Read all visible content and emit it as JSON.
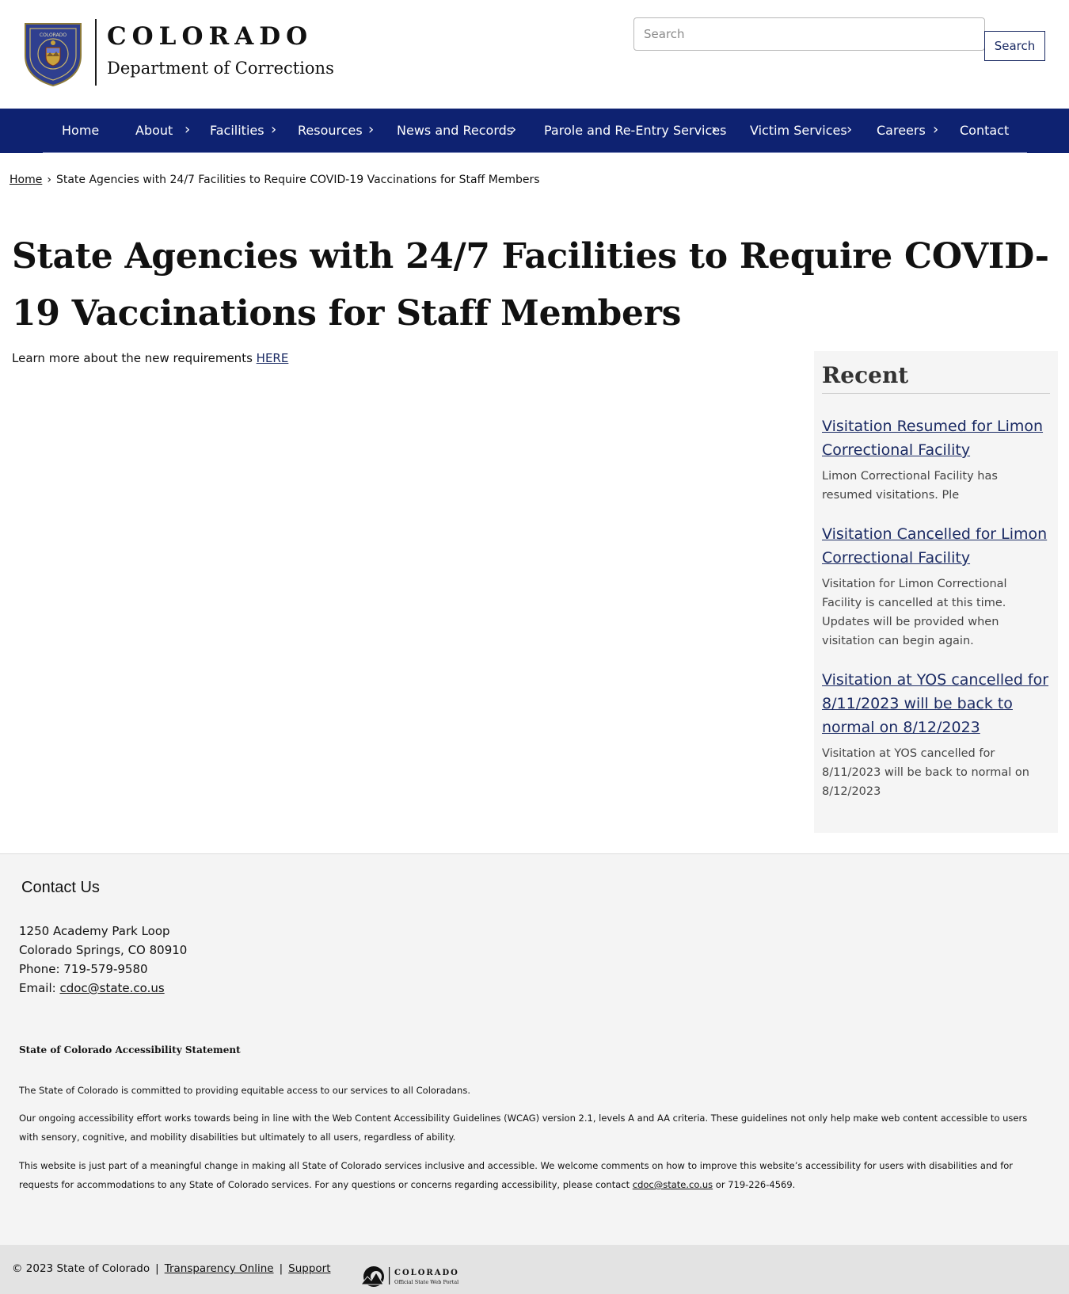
{
  "header": {
    "brand_co": "COLORADO",
    "brand_dept": "Department of Corrections",
    "search_placeholder": "Search",
    "search_button": "Search"
  },
  "nav": {
    "items": [
      {
        "label": "Home"
      },
      {
        "label": "About",
        "has_chevron": true
      },
      {
        "label": "Facilities",
        "has_chevron": true
      },
      {
        "label": "Resources",
        "has_chevron": true
      },
      {
        "label": "News and Records",
        "has_chevron": true
      },
      {
        "label": "Parole and Re-Entry Services",
        "has_chevron": true
      },
      {
        "label": "Victim Services",
        "has_chevron": true
      },
      {
        "label": "Careers",
        "has_chevron": true
      },
      {
        "label": "Contact"
      }
    ],
    "chevron_glyph": "›"
  },
  "breadcrumb": {
    "home": "Home",
    "separator": "›",
    "current": "State Agencies with 24/7 Facilities to Require COVID-19 Vaccinations for Staff Members"
  },
  "page": {
    "title": "State Agencies with 24/7 Facilities to Require COVID-19 Vaccinations for Staff Members",
    "intro_text": "Learn more about the new requirements",
    "intro_link": "HERE"
  },
  "sidebar": {
    "title": "Recent",
    "items": [
      {
        "title": "Visitation Resumed for Limon Correctional Facility",
        "snippet": "Limon Correctional Facility has resumed visitations.  Ple"
      },
      {
        "title": "Visitation Cancelled for Limon Correctional Facility",
        "snippet": "Visitation for Limon Correctional Facility is cancelled at this time. Updates will be provided when visitation can begin again."
      },
      {
        "title": "Visitation at YOS cancelled for 8/11/2023 will be back to normal on 8/12/2023",
        "snippet": "Visitation at YOS cancelled for 8/11/2023 will be back to normal on 8/12/2023"
      }
    ]
  },
  "footer": {
    "contact_title": "Contact Us",
    "address_line1": "1250 Academy Park Loop",
    "address_line2": "Colorado Springs, CO 80910",
    "phone": "Phone: 719-579-9580",
    "email_label": "Email:",
    "email": "cdoc@state.co.us",
    "a11y_title": "State of Colorado Accessibility Statement",
    "a11y_p1": "The State of Colorado is committed to providing equitable access to our services to all Coloradans.",
    "a11y_p2": "Our ongoing accessibility effort works towards being in line with the Web Content Accessibility Guidelines (WCAG) version 2.1, levels A and AA criteria. These guidelines not only help make web content accessible to users with sensory, cognitive, and mobility disabilities but ultimately to all users, regardless of ability.",
    "a11y_p3": "This website is just part of a meaningful change in making all State of Colorado services inclusive and accessible. We welcome comments on how to improve this website’s accessibility for users with disabilities and for requests for accommodations to any State of Colorado services. For any questions or concerns regarding accessibility, please contact",
    "a11y_p3_email": "cdoc@state.co.us",
    "a11y_p3_tail": "or 719-226-4569.",
    "copyright": "© 2023 State of Colorado",
    "sep": "|",
    "transparency": "Transparency Online",
    "support": "Support",
    "portal_logo_text": "COLORADO",
    "portal_logo_sub": "Official State Web Portal"
  },
  "colors": {
    "nav_bg": "#0e2271",
    "link": "#1a2a63",
    "footer_bg": "#f4f4f4",
    "bottom_bar_bg": "#e3e3e3",
    "sidebar_bg": "#f5f5f5"
  }
}
